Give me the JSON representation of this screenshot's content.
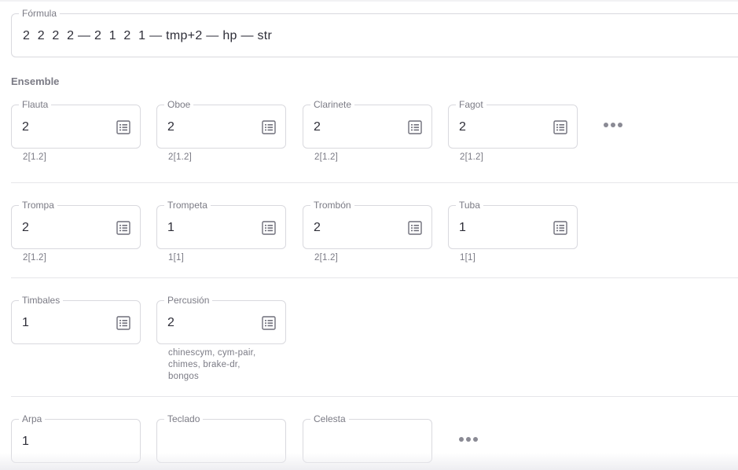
{
  "formula": {
    "label": "Fórmula",
    "value": "2  2  2  2 — 2  1  2  1 — tmp+2 — hp — str"
  },
  "ensemble": {
    "title": "Ensemble",
    "rows": [
      {
        "fields": [
          {
            "label": "Flauta",
            "value": "2",
            "hint": "2[1.2]"
          },
          {
            "label": "Oboe",
            "value": "2",
            "hint": "2[1.2]"
          },
          {
            "label": "Clarinete",
            "value": "2",
            "hint": "2[1.2]"
          },
          {
            "label": "Fagot",
            "value": "2",
            "hint": "2[1.2]"
          }
        ]
      },
      {
        "fields": [
          {
            "label": "Trompa",
            "value": "2",
            "hint": "2[1.2]"
          },
          {
            "label": "Trompeta",
            "value": "1",
            "hint": "1[1]"
          },
          {
            "label": "Trombón",
            "value": "2",
            "hint": "2[1.2]"
          },
          {
            "label": "Tuba",
            "value": "1",
            "hint": "1[1]"
          }
        ]
      },
      {
        "fields": [
          {
            "label": "Timbales",
            "value": "1",
            "hint": ""
          },
          {
            "label": "Percusión",
            "value": "2",
            "hint_lines": [
              "chinescym, cym-pair,",
              "chimes, brake-dr,",
              "bongos"
            ]
          }
        ]
      },
      {
        "fields": [
          {
            "label": "Arpa",
            "value": "1"
          },
          {
            "label": "Teclado",
            "value": ""
          },
          {
            "label": "Celesta",
            "value": ""
          }
        ]
      }
    ]
  },
  "icons": {
    "field_action": "list-icon",
    "more": "more-horizontal-icon"
  }
}
